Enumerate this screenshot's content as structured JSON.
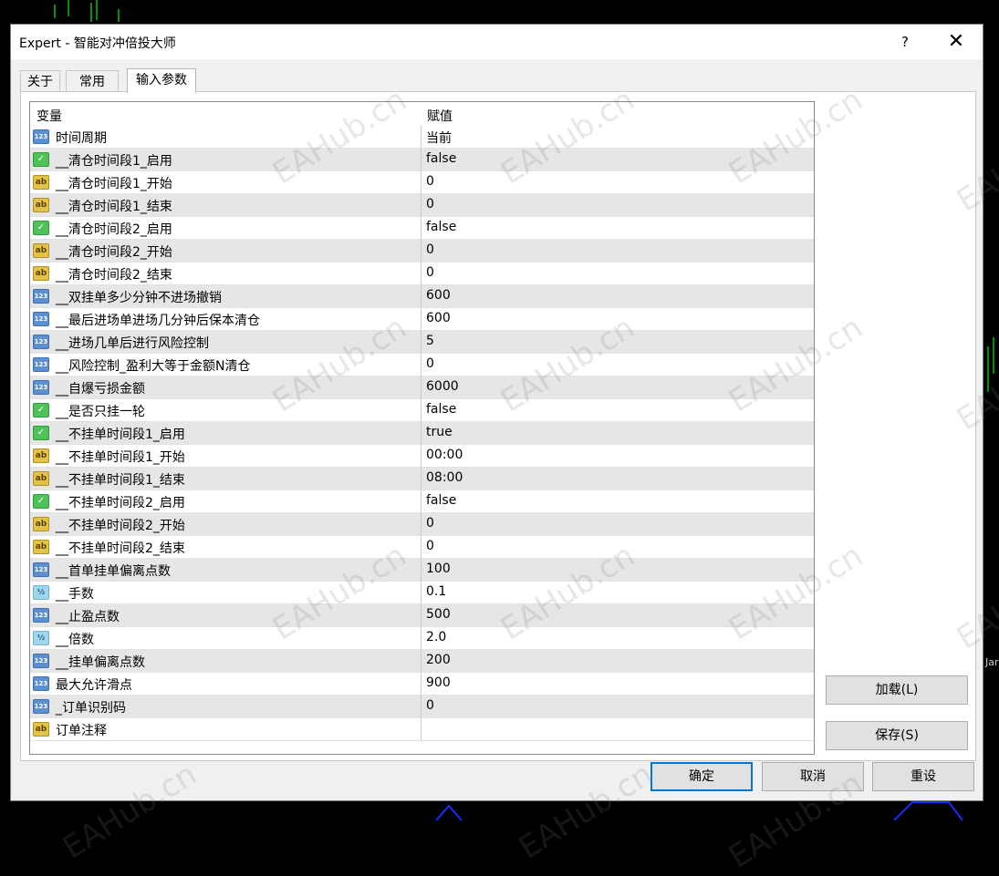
{
  "window": {
    "title": "Expert - 智能对冲倍投大师",
    "help_label": "?",
    "close_label": "✕"
  },
  "tabs": [
    {
      "label": "关于",
      "active": false
    },
    {
      "label": "常用",
      "active": false
    },
    {
      "label": "输入参数",
      "active": true
    }
  ],
  "table": {
    "headers": {
      "variable": "变量",
      "value": "赋值"
    },
    "rows": [
      {
        "icon": "123",
        "type": "num",
        "name": "时间周期",
        "value": "当前"
      },
      {
        "icon": "bool",
        "type": "bool",
        "name": "__清仓时间段1_启用",
        "value": "false"
      },
      {
        "icon": "ab",
        "type": "str",
        "name": "__清仓时间段1_开始",
        "value": "0"
      },
      {
        "icon": "ab",
        "type": "str",
        "name": "__清仓时间段1_结束",
        "value": "0"
      },
      {
        "icon": "bool",
        "type": "bool",
        "name": "__清仓时间段2_启用",
        "value": "false"
      },
      {
        "icon": "ab",
        "type": "str",
        "name": "__清仓时间段2_开始",
        "value": "0"
      },
      {
        "icon": "ab",
        "type": "str",
        "name": "__清仓时间段2_结束",
        "value": "0"
      },
      {
        "icon": "123",
        "type": "num",
        "name": "__双挂单多少分钟不进场撤销",
        "value": "600"
      },
      {
        "icon": "123",
        "type": "num",
        "name": "__最后进场单进场几分钟后保本清仓",
        "value": "600"
      },
      {
        "icon": "123",
        "type": "num",
        "name": "__进场几单后进行风险控制",
        "value": "5"
      },
      {
        "icon": "123",
        "type": "num",
        "name": "__风险控制_盈利大等于金额N清仓",
        "value": "0"
      },
      {
        "icon": "123",
        "type": "num",
        "name": "__自爆亏损金额",
        "value": "6000"
      },
      {
        "icon": "bool",
        "type": "bool",
        "name": "__是否只挂一轮",
        "value": "false"
      },
      {
        "icon": "bool",
        "type": "bool",
        "name": "__不挂单时间段1_启用",
        "value": "true"
      },
      {
        "icon": "ab",
        "type": "str",
        "name": "__不挂单时间段1_开始",
        "value": "00:00"
      },
      {
        "icon": "ab",
        "type": "str",
        "name": "__不挂单时间段1_结束",
        "value": "08:00"
      },
      {
        "icon": "bool",
        "type": "bool",
        "name": "__不挂单时间段2_启用",
        "value": "false"
      },
      {
        "icon": "ab",
        "type": "str",
        "name": "__不挂单时间段2_开始",
        "value": "0"
      },
      {
        "icon": "ab",
        "type": "str",
        "name": "__不挂单时间段2_结束",
        "value": "0"
      },
      {
        "icon": "123",
        "type": "num",
        "name": "__首单挂单偏离点数",
        "value": "100"
      },
      {
        "icon": "1/2",
        "type": "dbl",
        "name": "__手数",
        "value": "0.1"
      },
      {
        "icon": "123",
        "type": "num",
        "name": "__止盈点数",
        "value": "500"
      },
      {
        "icon": "1/2",
        "type": "dbl",
        "name": "__倍数",
        "value": "2.0"
      },
      {
        "icon": "123",
        "type": "num",
        "name": "__挂单偏离点数",
        "value": "200"
      },
      {
        "icon": "123",
        "type": "num",
        "name": "最大允许滑点",
        "value": "900"
      },
      {
        "icon": "123",
        "type": "num",
        "name": "_订单识别码",
        "value": "0"
      },
      {
        "icon": "ab",
        "type": "str",
        "name": "订单注释",
        "value": ""
      }
    ]
  },
  "buttons": {
    "load": "加载(L)",
    "save": "保存(S)",
    "ok": "确定",
    "cancel": "取消",
    "reset": "重设"
  },
  "watermark": "EAHub.cn",
  "background": {
    "label_jan": "Jar"
  }
}
